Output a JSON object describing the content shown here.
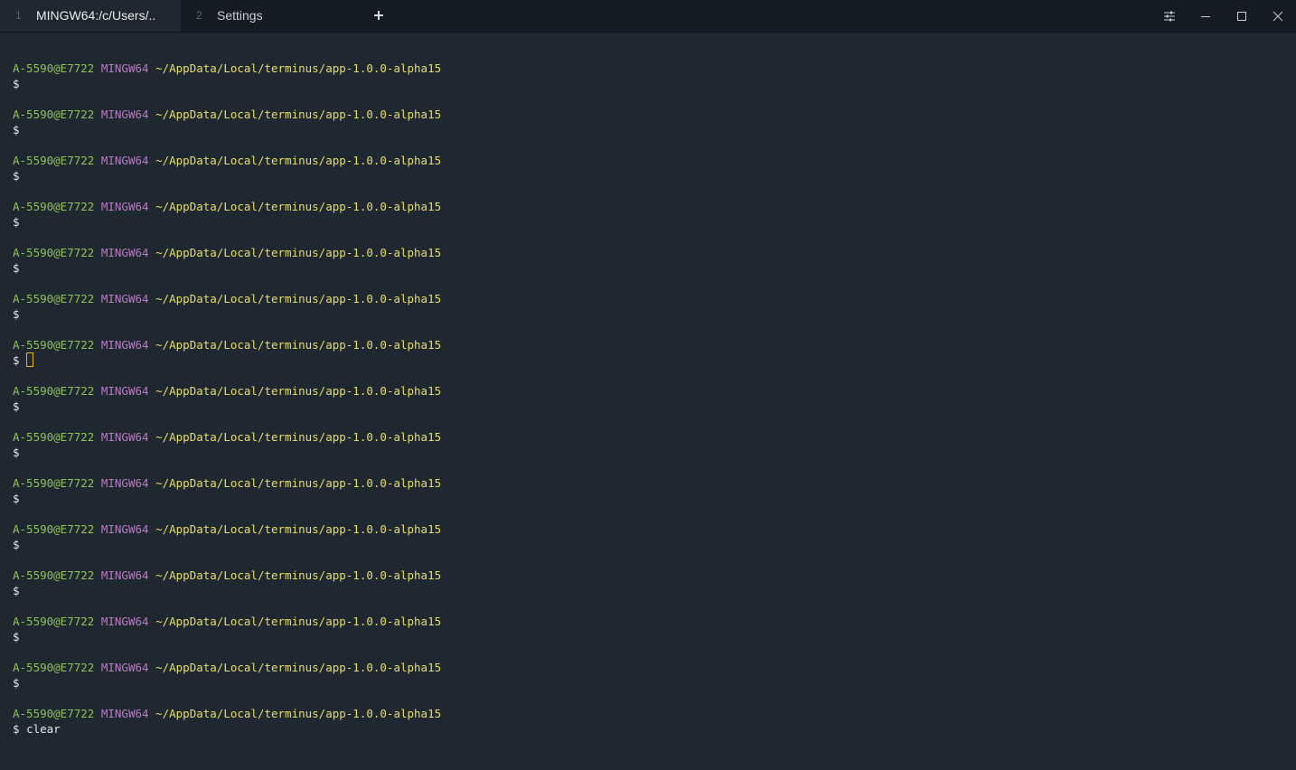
{
  "tabs": [
    {
      "index": "1",
      "title": "MINGW64:/c/Users/..",
      "active": true
    },
    {
      "index": "2",
      "title": "Settings",
      "active": false
    }
  ],
  "new_tab_icon": "plus-icon",
  "window_controls": [
    "settings-sliders-icon",
    "minimize-icon",
    "maximize-icon",
    "close-icon"
  ],
  "colors": {
    "background": "#1f2730",
    "titlebar": "#141b22",
    "user": "#8fc25a",
    "host": "#b77cc0",
    "path": "#e6de6a",
    "cursor": "#f0b400"
  },
  "terminal": {
    "prompts": [
      {
        "user": "A-5590@E7722",
        "host": "MINGW64",
        "path": "~/AppData/Local/terminus/app-1.0.0-alpha15",
        "dollar": "$",
        "command": ""
      },
      {
        "user": "A-5590@E7722",
        "host": "MINGW64",
        "path": "~/AppData/Local/terminus/app-1.0.0-alpha15",
        "dollar": "$",
        "command": ""
      },
      {
        "user": "A-5590@E7722",
        "host": "MINGW64",
        "path": "~/AppData/Local/terminus/app-1.0.0-alpha15",
        "dollar": "$",
        "command": ""
      },
      {
        "user": "A-5590@E7722",
        "host": "MINGW64",
        "path": "~/AppData/Local/terminus/app-1.0.0-alpha15",
        "dollar": "$",
        "command": ""
      },
      {
        "user": "A-5590@E7722",
        "host": "MINGW64",
        "path": "~/AppData/Local/terminus/app-1.0.0-alpha15",
        "dollar": "$",
        "command": ""
      },
      {
        "user": "A-5590@E7722",
        "host": "MINGW64",
        "path": "~/AppData/Local/terminus/app-1.0.0-alpha15",
        "dollar": "$",
        "command": ""
      },
      {
        "user": "A-5590@E7722",
        "host": "MINGW64",
        "path": "~/AppData/Local/terminus/app-1.0.0-alpha15",
        "dollar": "$",
        "command": "",
        "cursor": true
      },
      {
        "user": "A-5590@E7722",
        "host": "MINGW64",
        "path": "~/AppData/Local/terminus/app-1.0.0-alpha15",
        "dollar": "$",
        "command": ""
      },
      {
        "user": "A-5590@E7722",
        "host": "MINGW64",
        "path": "~/AppData/Local/terminus/app-1.0.0-alpha15",
        "dollar": "$",
        "command": ""
      },
      {
        "user": "A-5590@E7722",
        "host": "MINGW64",
        "path": "~/AppData/Local/terminus/app-1.0.0-alpha15",
        "dollar": "$",
        "command": ""
      },
      {
        "user": "A-5590@E7722",
        "host": "MINGW64",
        "path": "~/AppData/Local/terminus/app-1.0.0-alpha15",
        "dollar": "$",
        "command": ""
      },
      {
        "user": "A-5590@E7722",
        "host": "MINGW64",
        "path": "~/AppData/Local/terminus/app-1.0.0-alpha15",
        "dollar": "$",
        "command": ""
      },
      {
        "user": "A-5590@E7722",
        "host": "MINGW64",
        "path": "~/AppData/Local/terminus/app-1.0.0-alpha15",
        "dollar": "$",
        "command": ""
      },
      {
        "user": "A-5590@E7722",
        "host": "MINGW64",
        "path": "~/AppData/Local/terminus/app-1.0.0-alpha15",
        "dollar": "$",
        "command": ""
      },
      {
        "user": "A-5590@E7722",
        "host": "MINGW64",
        "path": "~/AppData/Local/terminus/app-1.0.0-alpha15",
        "dollar": "$",
        "command": "clear"
      }
    ]
  }
}
